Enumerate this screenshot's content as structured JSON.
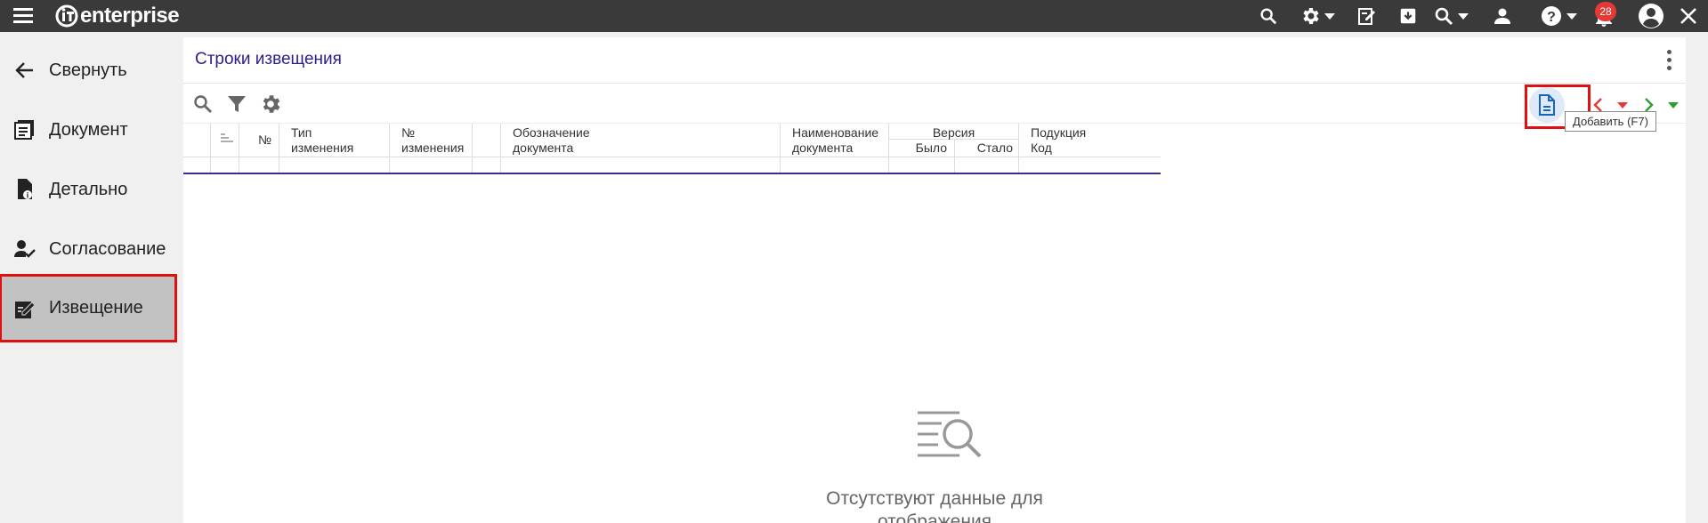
{
  "topbar": {
    "logo_text": "enterprise",
    "notifications_count": "28",
    "icons": [
      "menu-icon",
      "search-icon",
      "gear-icon",
      "edit-document-icon",
      "archive-icon",
      "search-options-icon",
      "user-icon",
      "help-icon",
      "bell-icon",
      "account-icon",
      "close-icon"
    ]
  },
  "sidebar": {
    "items": [
      {
        "label": "Свернуть",
        "icon": "arrow-left-icon"
      },
      {
        "label": "Документ",
        "icon": "document-list-icon"
      },
      {
        "label": "Детально",
        "icon": "document-info-icon"
      },
      {
        "label": "Согласование",
        "icon": "user-check-icon"
      },
      {
        "label": "Извещение",
        "icon": "edit-notice-icon",
        "active": true
      }
    ]
  },
  "panel": {
    "title": "Строки извещения",
    "add_tooltip": "Добавить (F7)"
  },
  "table": {
    "headers": {
      "num": "№",
      "change_type": [
        "Тип",
        "изменения"
      ],
      "change_num": [
        "№",
        "изменения"
      ],
      "doc_designation": [
        "Обозначение",
        "документа"
      ],
      "doc_name": [
        "Наименование",
        "документа"
      ],
      "version": "Версия",
      "was": "Было",
      "became": "Стало",
      "subproduct": [
        "Подукция",
        "Код"
      ]
    }
  },
  "empty_state": {
    "text_line1": "Отсутствуют данные для",
    "text_line2": "отображения"
  },
  "colors": {
    "topbar": "#3a3a3a",
    "title": "#2a1f8e",
    "highlight": "#e01010",
    "active_item": "#c2c2c2",
    "badge": "#e53935"
  }
}
